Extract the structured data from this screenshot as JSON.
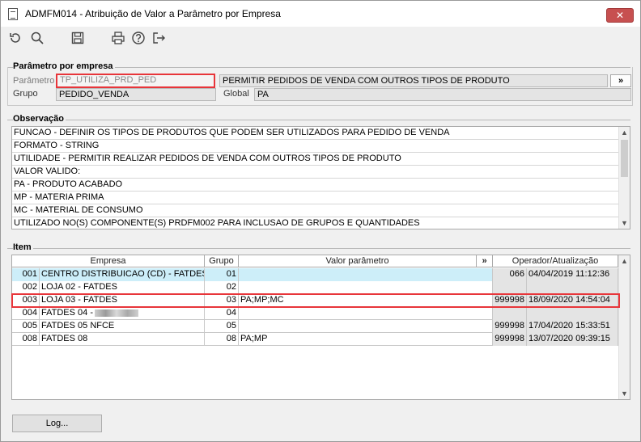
{
  "window": {
    "title": "ADMFM014 - Atribuição de Valor a Parâmetro por Empresa",
    "close_label": "✕"
  },
  "toolbar": {
    "icons": [
      "refresh-icon",
      "search-icon",
      "save-icon",
      "print-icon",
      "help-icon",
      "exit-icon"
    ]
  },
  "param_group": {
    "title": "Parâmetro por empresa",
    "parametro_label": "Parâmetro",
    "parametro_value": "TP_UTILIZA_PRD_PED",
    "parametro_desc": "PERMITIR PEDIDOS DE VENDA COM OUTROS TIPOS DE PRODUTO",
    "more_label": "»",
    "grupo_label": "Grupo",
    "grupo_value": "PEDIDO_VENDA",
    "global_label": "Global",
    "global_value": "PA"
  },
  "observacao": {
    "title": "Observação",
    "lines": [
      "FUNCAO - DEFINIR OS TIPOS DE PRODUTOS QUE PODEM SER UTILIZADOS PARA PEDIDO DE VENDA",
      "FORMATO - STRING",
      "UTILIDADE - PERMITIR REALIZAR PEDIDOS DE VENDA COM OUTROS TIPOS DE PRODUTO",
      "VALOR VALIDO:",
      "PA - PRODUTO ACABADO",
      "MP - MATERIA PRIMA",
      "MC - MATERIAL DE CONSUMO",
      "UTILIZADO NO(S) COMPONENTE(S) PRDFM002  PARA  INCLUSAO DE GRUPOS E QUANTIDADES"
    ]
  },
  "item": {
    "title": "Item",
    "columns": {
      "empresa": "Empresa",
      "grupo": "Grupo",
      "valor": "Valor parâmetro",
      "more": "»",
      "operador": "Operador/Atualização"
    },
    "rows": [
      {
        "cod": "001",
        "empresa": "CENTRO DISTRIBUICAO (CD) - FATDES",
        "grupo": "01",
        "valor": "",
        "operador": "066",
        "data": "04/04/2019 11:12:36"
      },
      {
        "cod": "002",
        "empresa": "LOJA 02 - FATDES",
        "grupo": "02",
        "valor": "",
        "operador": "",
        "data": ""
      },
      {
        "cod": "003",
        "empresa": "LOJA 03 - FATDES",
        "grupo": "03",
        "valor": "PA;MP;MC",
        "operador": "999998",
        "data": "18/09/2020 14:54:04"
      },
      {
        "cod": "004",
        "empresa": "FATDES 04 -",
        "grupo": "04",
        "valor": "",
        "operador": "",
        "data": ""
      },
      {
        "cod": "005",
        "empresa": "FATDES 05 NFCE",
        "grupo": "05",
        "valor": "",
        "operador": "999998",
        "data": "17/04/2020 15:33:51"
      },
      {
        "cod": "008",
        "empresa": "FATDES 08",
        "grupo": "08",
        "valor": "PA;MP",
        "operador": "999998",
        "data": "13/07/2020 09:39:15"
      }
    ]
  },
  "log_button": "Log..."
}
